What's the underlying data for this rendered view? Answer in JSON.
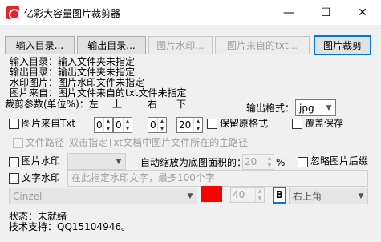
{
  "window": {
    "title": "亿彩大容量图片裁剪器",
    "minimize_icon": "—",
    "maximize_icon": "☐",
    "close_icon": "✕"
  },
  "toolbar": {
    "input_dir": "输入目录...",
    "output_dir": "输出目录...",
    "watermark_img": "图片水印...",
    "from_txt": "图片来自的txt...",
    "crop": "图片裁剪"
  },
  "info": {
    "input_dir": "输入目录：输入文件夹未指定",
    "output_dir": "输出目录：输出文件夹未指定",
    "watermark_img": "水印图片：图片水印文件未指定",
    "from_txt": "图片来自：图片文件来自的txt文件未指定"
  },
  "crop_params": {
    "label": "裁剪参数(单位%)：左",
    "top_label": "上",
    "right_label": "右",
    "bottom_label": "下",
    "left_value": "0",
    "top_value": "0",
    "right_value": "0",
    "bottom_value": "20"
  },
  "output_format": {
    "label": "输出格式：",
    "value": "jpg"
  },
  "options": {
    "from_txt_label": "图片来自Txt",
    "keep_format_label": "保留原格式",
    "overwrite_label": "覆盖保存",
    "file_path_label": "文件路径",
    "file_path_hint": "双击指定Txt文档中图片文件所在的主路径",
    "image_watermark_label": "图片水印",
    "auto_scale_label": "自动缩放为底图面积的：",
    "auto_scale_value": "20",
    "percent_sign": "%",
    "ignore_corner_label": "忽略图片后缀",
    "text_watermark_label": "文字水印",
    "text_watermark_placeholder": "在此指定水印文字，最多100个字"
  },
  "text_style": {
    "font": "Cinzel",
    "color": "#ff0000",
    "size": "40",
    "bold": "B",
    "position": "右上角"
  },
  "status": {
    "state": "状态：未就绪",
    "support": "技术支持：QQ15104946。"
  }
}
